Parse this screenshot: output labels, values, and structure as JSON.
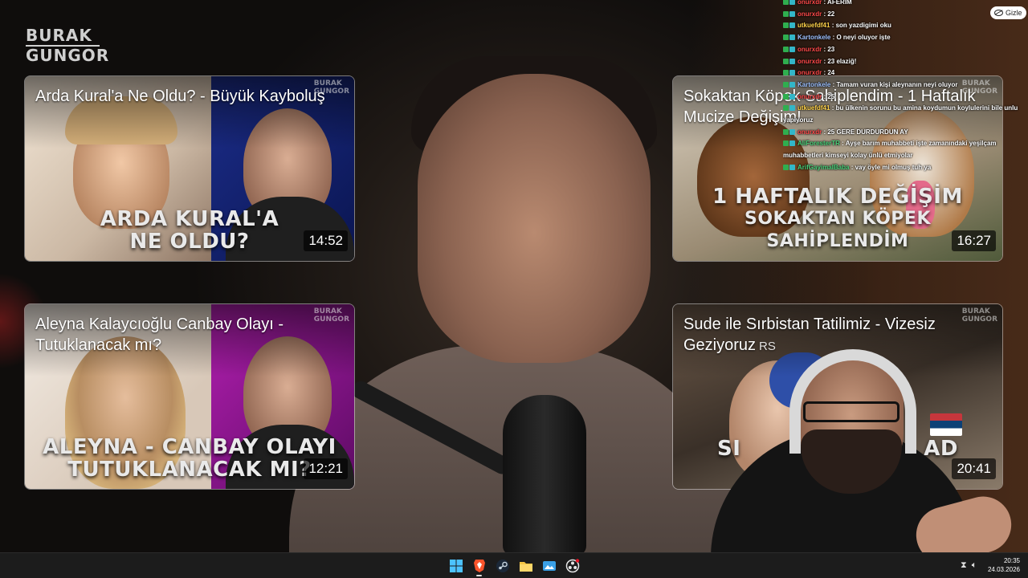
{
  "logo": {
    "line1": "BURAK",
    "line2": "GUNGOR"
  },
  "cards": [
    {
      "title": "Arda Kural'a Ne Oldu? - Büyük Kayboluş",
      "caption1": "ARDA KURAL'A",
      "caption2": "NE OLDU?",
      "duration": "14:52"
    },
    {
      "title": "Sokaktan Köpek Sahiplendim - 1 Haftalık Mucize Değişim!",
      "caption1": "1 HAFTALIK DEĞİŞİM",
      "caption2": "SOKAKTAN KÖPEK SAHİPLENDİM",
      "duration": "16:27"
    },
    {
      "title": "Aleyna Kalaycıoğlu Canbay Olayı - Tutuklanacak mı?",
      "caption1": "ALEYNA - CANBAY OLAYI",
      "caption2": "TUTUKLANACAK MI?",
      "duration": "12:21"
    },
    {
      "title": "Sude ile Sırbistan Tatilimiz - Vizesiz Geziyoruz",
      "tag": "RS",
      "caption1": "SI",
      "caption2": "AD",
      "duration": "20:41"
    }
  ],
  "mini_logo": {
    "line1": "BURAK",
    "line2": "GUNGOR"
  },
  "hide_button": {
    "label": "Gizle",
    "icon": "eye-off-icon"
  },
  "chat": [
    {
      "user": "onurxdr",
      "message": ": AFERIM",
      "color": "#ff4a4a"
    },
    {
      "user": "onurxdr",
      "message": ": 22",
      "color": "#ff4a4a"
    },
    {
      "user": "utkuefdf41",
      "message": ": son yazdigimi oku",
      "color": "#ffd24a"
    },
    {
      "user": "Kartonkele",
      "message": ": O neyi oluyor işte",
      "color": "#9fc2ff"
    },
    {
      "user": "onurxdr",
      "message": ": 23",
      "color": "#ff4a4a"
    },
    {
      "user": "onurxdr",
      "message": ": 23 elaziğ!",
      "color": "#ff4a4a"
    },
    {
      "user": "onurxdr",
      "message": ": 24",
      "color": "#ff4a4a"
    },
    {
      "user": "Kartonkele",
      "message": ": Tamam vuran kişi aleynanın neyi oluyor",
      "color": "#9fc2ff"
    },
    {
      "user": "onurxdr",
      "message": ": 25",
      "color": "#ff4a4a"
    },
    {
      "user": "utkuefdf41",
      "message": ": bu ülkenin sorunu bu amina koydumun koylulerini bile unlu yapiyoruz",
      "color": "#ffd24a"
    },
    {
      "user": "onurxdr",
      "message": ": 25 GERE DURDURDUN AY",
      "color": "#ff4a4a"
    },
    {
      "user": "AliForesterTR",
      "message": ": Ayşe barım muhabbeti işte zamanındaki yeşilçam muhabbetleri kimseyi kolay ünlü etmiyolar",
      "color": "#4ad27a"
    },
    {
      "user": "ArifGayimalBaba",
      "message": ": vay öyle mi olmuş tuh ya",
      "color": "#4ad27a"
    }
  ],
  "taskbar": {
    "apps": [
      "windows-start-icon",
      "brave-browser-icon",
      "steam-icon",
      "file-explorer-icon",
      "photos-icon",
      "obs-icon"
    ],
    "time": "20:35",
    "date": "24.03.2026"
  }
}
